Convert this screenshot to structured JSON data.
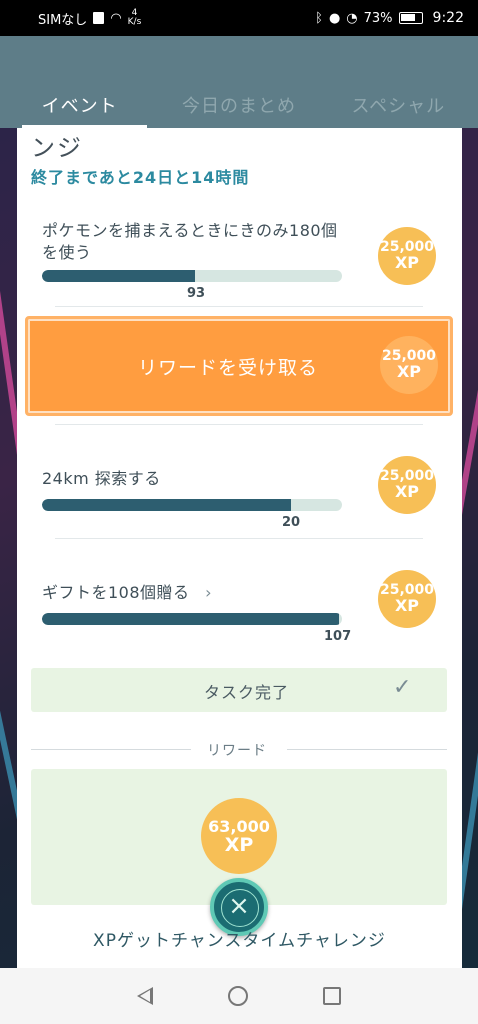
{
  "status_bar": {
    "carrier": "SIMなし",
    "speed_value": "4",
    "speed_unit": "K/s",
    "battery": "73%",
    "time": "9:22"
  },
  "tabs": [
    {
      "label": "イベント",
      "active": true
    },
    {
      "label": "今日のまとめ",
      "active": false
    },
    {
      "label": "スペシャル",
      "active": false
    }
  ],
  "challenge": {
    "title_fragment": "ンジ",
    "countdown": "終了まであと24日と14時間",
    "tasks": [
      {
        "text": "ポケモンを捕まえるときにきのみ180個を使う",
        "progress_label": "93",
        "progress_fraction": 0.51,
        "xp_amount": "25,000",
        "xp_unit": "XP"
      },
      {
        "text": "24km 探索する",
        "progress_label": "20",
        "progress_fraction": 0.83,
        "xp_amount": "25,000",
        "xp_unit": "XP"
      },
      {
        "text": "ギフトを108個贈る",
        "progress_label": "107",
        "progress_fraction": 0.99,
        "xp_amount": "25,000",
        "xp_unit": "XP"
      }
    ],
    "claim_button": {
      "label": "リワードを受け取る",
      "xp_amount": "25,000",
      "xp_unit": "XP"
    },
    "task_complete_label": "タスク完了",
    "reward_header": "リワード",
    "reward": {
      "xp_amount": "63,000",
      "xp_unit": "XP"
    },
    "footer_title": "XPゲットチャンスタイムチャレンジ"
  },
  "colors": {
    "header_bg": "#5e7d88",
    "accent_teal": "#2c8aa0",
    "progress_fill": "#2d5e70",
    "xp_gold": "#f7bf56",
    "claim_orange": "#ff9d40",
    "complete_green": "#e8f4e3"
  }
}
